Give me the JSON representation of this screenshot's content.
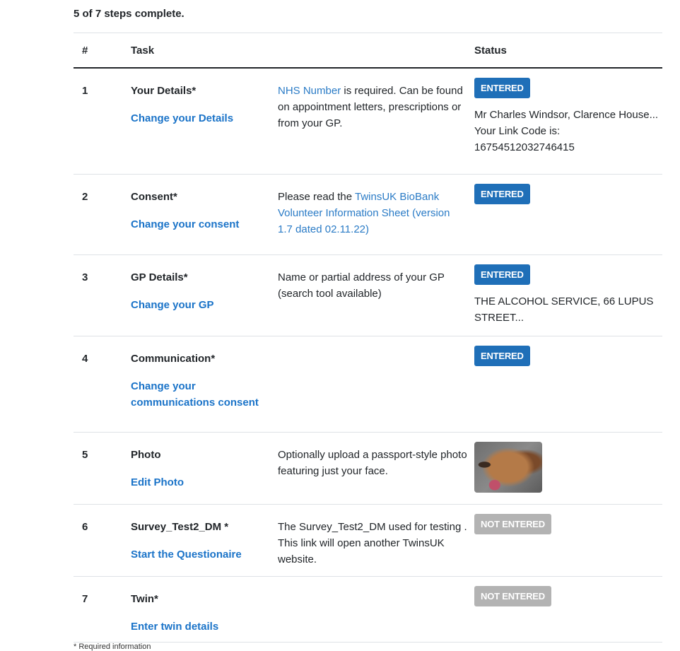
{
  "summary": "5 of 7 steps complete.",
  "headers": {
    "num": "#",
    "task": "Task",
    "desc": "",
    "status": "Status"
  },
  "rows": [
    {
      "num": "1",
      "title": "Your Details*",
      "link": "Change your Details",
      "desc_link": "NHS Number",
      "desc_pre": "",
      "desc_post": " is required. Can be found on appointment letters, prescriptions or from your GP.",
      "status": "ENTERED",
      "info": [
        "Mr Charles Windsor, Clarence House...",
        "Your Link Code is:",
        "16754512032746415"
      ]
    },
    {
      "num": "2",
      "title": "Consent*",
      "link": "Change your consent",
      "desc_pre": "Please read the ",
      "desc_link": "TwinsUK BioBank Volunteer Information Sheet (version 1.7 dated 02.11.22)",
      "desc_post": "",
      "status": "ENTERED",
      "info": []
    },
    {
      "num": "3",
      "title": "GP Details*",
      "link": "Change your GP",
      "desc_pre": "Name or partial address of your GP (search tool available)",
      "desc_link": "",
      "desc_post": "",
      "status": "ENTERED",
      "info": [
        "THE ALCOHOL SERVICE, 66 LUPUS STREET..."
      ]
    },
    {
      "num": "4",
      "title": "Communication*",
      "link": "Change your communications consent",
      "desc_pre": "",
      "desc_link": "",
      "desc_post": "",
      "status": "ENTERED",
      "info": []
    },
    {
      "num": "5",
      "title": "Photo",
      "link": "Edit Photo",
      "desc_pre": "Optionally upload a passport-style photo featuring just your face.",
      "desc_link": "",
      "desc_post": "",
      "status": "",
      "photo": "dog-photo",
      "info": []
    },
    {
      "num": "6",
      "title": "Survey_Test2_DM *",
      "link": "Start the Questionaire",
      "desc_pre": "The Survey_Test2_DM used for testing . This link will open another TwinsUK website.",
      "desc_link": "",
      "desc_post": "",
      "status": "NOT ENTERED",
      "info": []
    },
    {
      "num": "7",
      "title": "Twin*",
      "link": "Enter twin details",
      "desc_pre": "",
      "desc_link": "",
      "desc_post": "",
      "status": "NOT ENTERED",
      "info": []
    }
  ],
  "footnote": "* Required information",
  "colors": {
    "entered": "#1f6fb8",
    "not_entered": "#b3b3b3",
    "link": "#1a73c8"
  }
}
